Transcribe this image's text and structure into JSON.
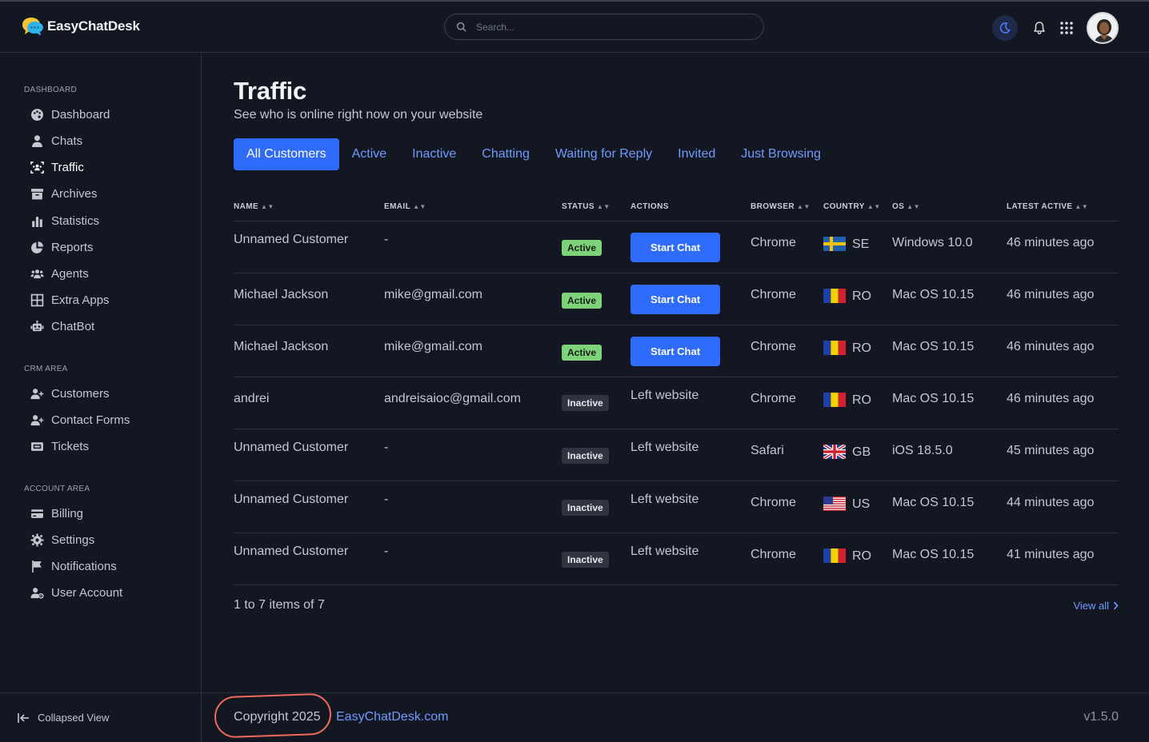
{
  "app": {
    "brand": "EasyChatDesk",
    "search_placeholder": "Search...",
    "version": "v1.5.0"
  },
  "sidebar": {
    "sections": [
      {
        "label": "DASHBOARD"
      },
      {
        "label": "CRM AREA"
      },
      {
        "label": "ACCOUNT AREA"
      }
    ],
    "items": [
      {
        "label": "Dashboard",
        "icon": "palette-icon"
      },
      {
        "label": "Chats",
        "icon": "user-icon"
      },
      {
        "label": "Traffic",
        "icon": "traffic-icon",
        "active": true
      },
      {
        "label": "Archives",
        "icon": "archive-icon"
      },
      {
        "label": "Statistics",
        "icon": "bar-chart-icon"
      },
      {
        "label": "Reports",
        "icon": "pie-chart-icon"
      },
      {
        "label": "Agents",
        "icon": "users-icon"
      },
      {
        "label": "Extra Apps",
        "icon": "grid-icon"
      },
      {
        "label": "ChatBot",
        "icon": "robot-icon"
      },
      {
        "label": "Customers",
        "icon": "user-plus-icon"
      },
      {
        "label": "Contact Forms",
        "icon": "user-plus-icon"
      },
      {
        "label": "Tickets",
        "icon": "ticket-icon"
      },
      {
        "label": "Billing",
        "icon": "credit-card-icon"
      },
      {
        "label": "Settings",
        "icon": "gear-icon"
      },
      {
        "label": "Notifications",
        "icon": "flag-icon"
      },
      {
        "label": "User Account",
        "icon": "user-cog-icon"
      }
    ],
    "collapse_label": "Collapsed View"
  },
  "page": {
    "title": "Traffic",
    "subtitle": "See who is online right now on your website"
  },
  "tabs": [
    {
      "label": "All Customers",
      "active": true
    },
    {
      "label": "Active"
    },
    {
      "label": "Inactive"
    },
    {
      "label": "Chatting"
    },
    {
      "label": "Waiting for Reply"
    },
    {
      "label": "Invited"
    },
    {
      "label": "Just Browsing"
    }
  ],
  "table": {
    "headers": {
      "name": "NAME",
      "email": "EMAIL",
      "status": "STATUS",
      "actions": "ACTIONS",
      "browser": "BROWSER",
      "country": "COUNTRY",
      "os": "OS",
      "latest": "LATEST ACTIVE"
    },
    "rows": [
      {
        "name": "Unnamed Customer",
        "email": "-",
        "status": "Active",
        "action": "Start Chat",
        "browser": "Chrome",
        "country": "SE",
        "os": "Windows 10.0",
        "latest": "46 minutes ago"
      },
      {
        "name": "Michael Jackson",
        "email": "mike@gmail.com",
        "status": "Active",
        "action": "Start Chat",
        "browser": "Chrome",
        "country": "RO",
        "os": "Mac OS 10.15",
        "latest": "46 minutes ago"
      },
      {
        "name": "Michael Jackson",
        "email": "mike@gmail.com",
        "status": "Active",
        "action": "Start Chat",
        "browser": "Chrome",
        "country": "RO",
        "os": "Mac OS 10.15",
        "latest": "46 minutes ago"
      },
      {
        "name": "andrei",
        "email": "andreisaioc@gmail.com",
        "status": "Inactive",
        "action": "Left website",
        "browser": "Chrome",
        "country": "RO",
        "os": "Mac OS 10.15",
        "latest": "46 minutes ago"
      },
      {
        "name": "Unnamed Customer",
        "email": "-",
        "status": "Inactive",
        "action": "Left website",
        "browser": "Safari",
        "country": "GB",
        "os": "iOS 18.5.0",
        "latest": "45 minutes ago"
      },
      {
        "name": "Unnamed Customer",
        "email": "-",
        "status": "Inactive",
        "action": "Left website",
        "browser": "Chrome",
        "country": "US",
        "os": "Mac OS 10.15",
        "latest": "44 minutes ago"
      },
      {
        "name": "Unnamed Customer",
        "email": "-",
        "status": "Inactive",
        "action": "Left website",
        "browser": "Chrome",
        "country": "RO",
        "os": "Mac OS 10.15",
        "latest": "41 minutes ago"
      }
    ]
  },
  "pager": {
    "summary": "1 to 7 items of 7",
    "view_all": "View all"
  },
  "footer": {
    "copyright": "Copyright 2025",
    "link": "EasyChatDesk.com"
  },
  "colors": {
    "background": "#131722",
    "accent": "#2f6bff",
    "link": "#6e9bff",
    "active_badge": "#7ed37a",
    "inactive_badge": "#2f3440",
    "annotation": "#f06a5a"
  }
}
